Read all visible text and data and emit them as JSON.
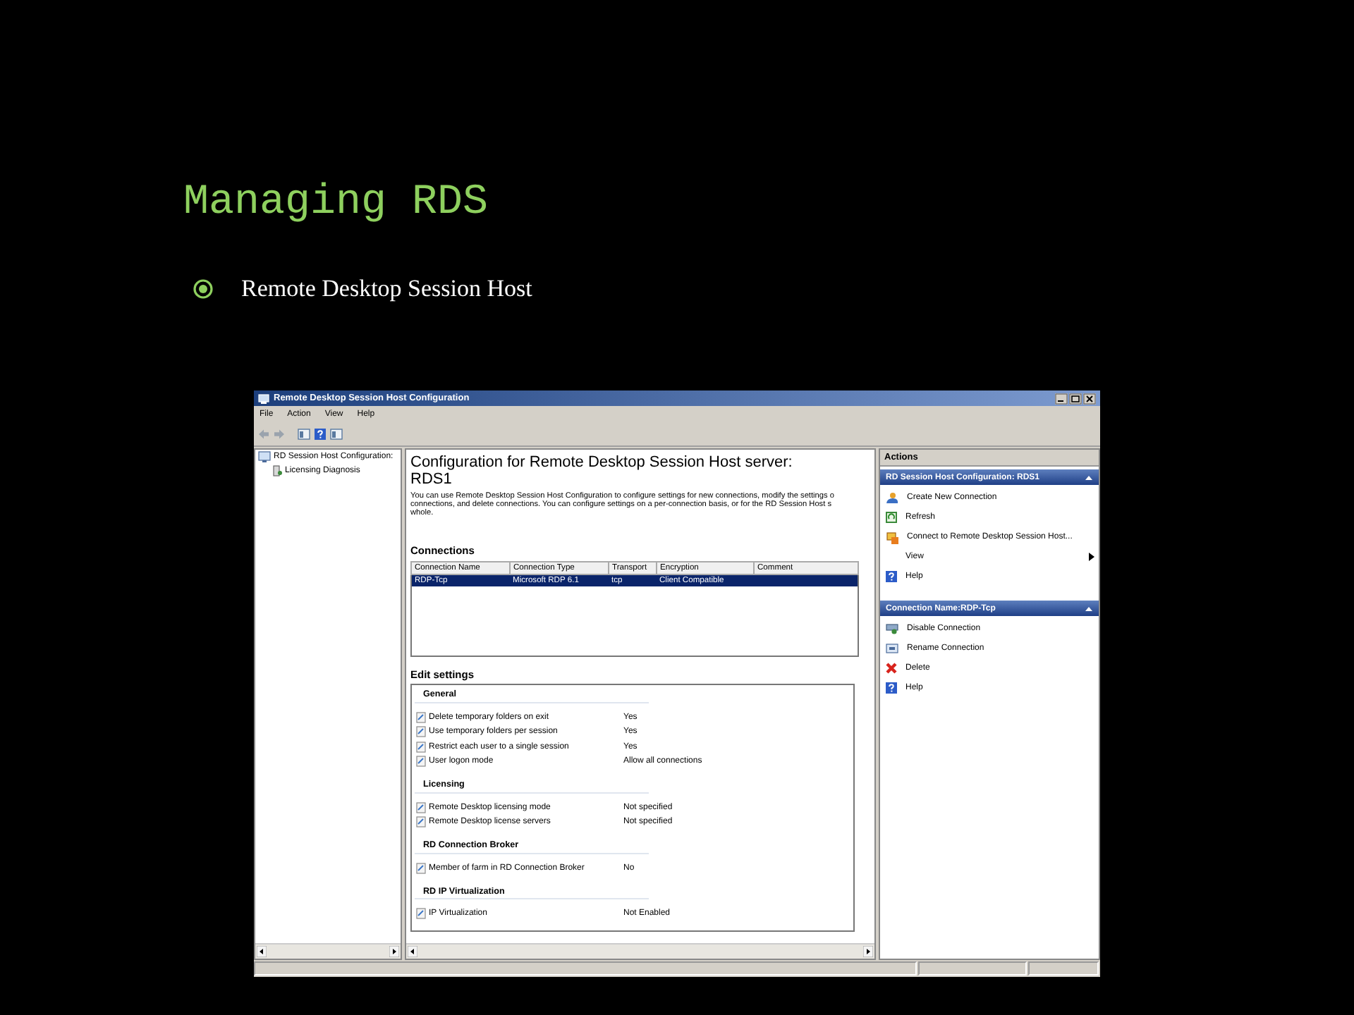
{
  "slide": {
    "title": "Managing RDS",
    "bullets": [
      "Remote Desktop Session Host"
    ]
  },
  "window": {
    "title": "Remote Desktop Session Host Configuration"
  },
  "menu": [
    "File",
    "Action",
    "View",
    "Help"
  ],
  "tree": [
    {
      "label": "RD Session Host Configuration:",
      "children": [
        {
          "label": "Licensing Diagnosis"
        }
      ]
    }
  ],
  "content": {
    "heading": "Configuration for Remote Desktop Session Host server:",
    "server": "RDS1",
    "description_lines": [
      "You can use Remote Desktop Session Host Configuration to configure settings for new connections, modify the settings o",
      "connections, and delete connections. You can configure settings on a per-connection basis, or for the RD Session Host s",
      "whole."
    ],
    "connections": {
      "title": "Connections",
      "columns": [
        "Connection Name",
        "Connection Type",
        "Transport",
        "Encryption",
        "Comment"
      ],
      "rows": [
        {
          "cells": [
            "RDP-Tcp",
            "Microsoft RDP 6.1",
            "tcp",
            "Client Compatible",
            ""
          ],
          "selected": true
        }
      ]
    },
    "edit_settings": {
      "title": "Edit settings",
      "groups": [
        {
          "name": "General",
          "settings": [
            {
              "name": "Delete temporary folders on exit",
              "value": "Yes"
            },
            {
              "name": "Use temporary folders per session",
              "value": "Yes"
            },
            {
              "name": "Restrict each user to a single session",
              "value": "Yes"
            },
            {
              "name": "User logon mode",
              "value": "Allow all connections"
            }
          ]
        },
        {
          "name": "Licensing",
          "settings": [
            {
              "name": "Remote Desktop licensing mode",
              "value": "Not specified"
            },
            {
              "name": "Remote Desktop license servers",
              "value": "Not specified"
            }
          ]
        },
        {
          "name": "RD Connection Broker",
          "settings": [
            {
              "name": "Member of farm in RD Connection Broker",
              "value": "No"
            }
          ]
        },
        {
          "name": "RD IP Virtualization",
          "settings": [
            {
              "name": "IP Virtualization",
              "value": "Not Enabled"
            }
          ]
        }
      ]
    }
  },
  "actions": {
    "title": "Actions",
    "sections": [
      {
        "title": "RD Session Host Configuration: RDS1",
        "items": [
          {
            "label": "Create New Connection",
            "kind": "item"
          },
          {
            "label": "Refresh",
            "kind": "item"
          },
          {
            "label": "Connect to Remote Desktop Session Host...",
            "kind": "item"
          },
          {
            "label": "View",
            "kind": "submenu"
          },
          {
            "label": "Help",
            "kind": "item"
          }
        ]
      },
      {
        "title": "Connection Name:RDP-Tcp",
        "items": [
          {
            "label": "Disable Connection",
            "kind": "item"
          },
          {
            "label": "Rename Connection",
            "kind": "item"
          },
          {
            "label": "Delete",
            "kind": "item"
          },
          {
            "label": "Help",
            "kind": "item"
          }
        ]
      }
    ]
  }
}
